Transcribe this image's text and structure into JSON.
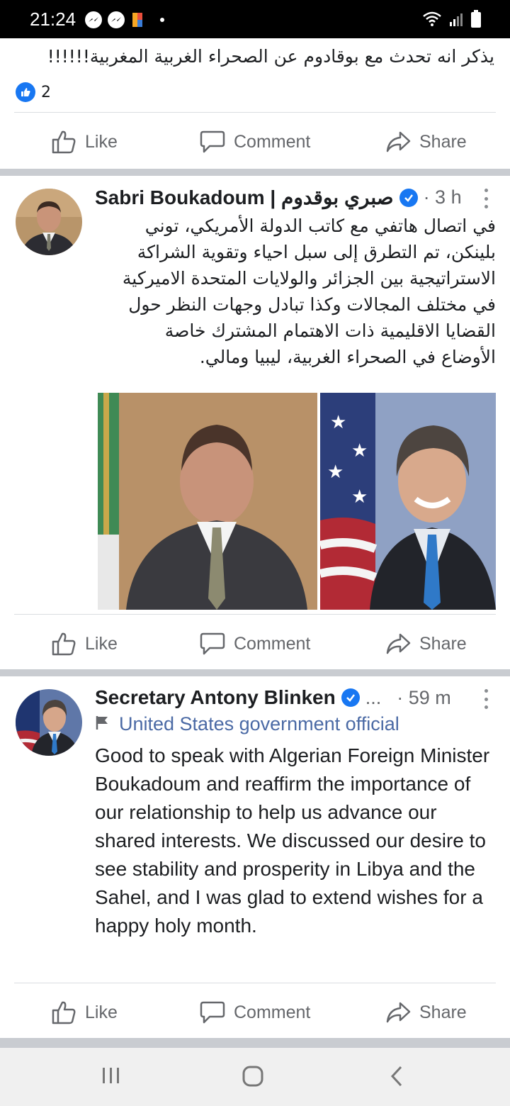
{
  "status_bar": {
    "time": "21:24",
    "icons": [
      "messenger-icon",
      "messenger-icon",
      "app-notification-icon"
    ],
    "right_icons": [
      "wifi-icon",
      "signal-icon",
      "battery-icon"
    ]
  },
  "snippet": {
    "text": "يذكر انه تحدث مع بوقادوم عن الصحراء الغربية المغربية!!!!!!",
    "reaction_count": "2"
  },
  "actions": {
    "like": "Like",
    "comment": "Comment",
    "share": "Share"
  },
  "posts": [
    {
      "author": "Sabri Boukadoum | صبري بوقدوم",
      "verified": true,
      "time": "· 3 h",
      "text": "في اتصال هاتفي مع كاتب الدولة الأمريكي، توني بلينكن، تم التطرق إلى سبل احياء وتقوية الشراكة الاستراتيجية بين الجزائر والولايات المتحدة الاميركية في مختلف المجالات وكذا تبادل وجهات النظر حول القضايا الاقليمية ذات الاهتمام المشترك خاصة الأوضاع في الصحراء الغربية، ليبيا ومالي."
    },
    {
      "author": "Secretary Antony Blinken",
      "verified": true,
      "ellipsis": "...",
      "time": "· 59 m",
      "subtitle": "United States government official",
      "text": "Good to speak with Algerian Foreign Minister Boukadoum and reaffirm the importance of our relationship to help us advance our shared interests. We discussed our desire to see stability and prosperity in Libya and the Sahel, and I was glad to extend wishes for a happy holy month."
    }
  ],
  "colors": {
    "facebook_blue": "#1877f2",
    "meta_gray": "#65676b",
    "subtitle_blue": "#4b6aa5"
  }
}
